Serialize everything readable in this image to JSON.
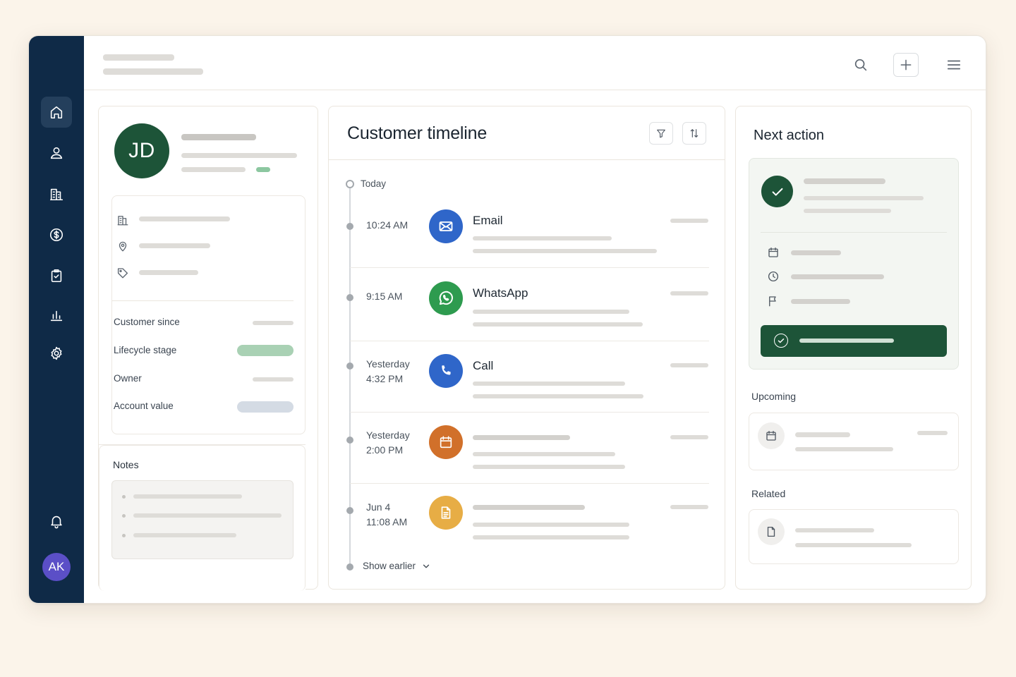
{
  "sidebar": {
    "items": [
      {
        "icon": "home-icon",
        "active": true
      },
      {
        "icon": "user-icon"
      },
      {
        "icon": "building-icon"
      },
      {
        "icon": "dollar-icon"
      },
      {
        "icon": "clipboard-check-icon"
      },
      {
        "icon": "bar-chart-icon"
      },
      {
        "icon": "gear-icon"
      }
    ],
    "bell_icon": "bell-icon",
    "user_initials": "AK"
  },
  "profile": {
    "initials": "JD",
    "fields": [
      {
        "label": "Customer since"
      },
      {
        "label": "Lifecycle stage"
      },
      {
        "label": "Owner"
      },
      {
        "label": "Account value"
      }
    ],
    "notes_title": "Notes"
  },
  "timeline": {
    "title": "Customer timeline",
    "today_label": "Today",
    "entries": [
      {
        "time": "10:24 AM",
        "name": "Email",
        "color": "#2f66c9",
        "icon": "mail-icon"
      },
      {
        "time": "9:15 AM",
        "name": "WhatsApp",
        "color": "#2e9b4f",
        "icon": "whatsapp-icon"
      },
      {
        "time_line1": "Yesterday",
        "time_line2": "4:32 PM",
        "name": "Call",
        "color": "#2f66c9",
        "icon": "phone-icon"
      },
      {
        "time_line1": "Yesterday",
        "time_line2": "2:00 PM",
        "name": "",
        "color": "#d1702a",
        "icon": "calendar-icon"
      },
      {
        "time_line1": "Jun 4",
        "time_line2": "11:08 AM",
        "name": "",
        "color": "#e7ad45",
        "icon": "document-icon"
      }
    ],
    "show_earlier": "Show earlier"
  },
  "next_action": {
    "title": "Next action",
    "upcoming_title": "Upcoming",
    "related_title": "Related"
  },
  "colors": {
    "sidebar": "#0f2a47",
    "brand_green": "#1d5438",
    "avatar_purple": "#5b4fc7"
  }
}
